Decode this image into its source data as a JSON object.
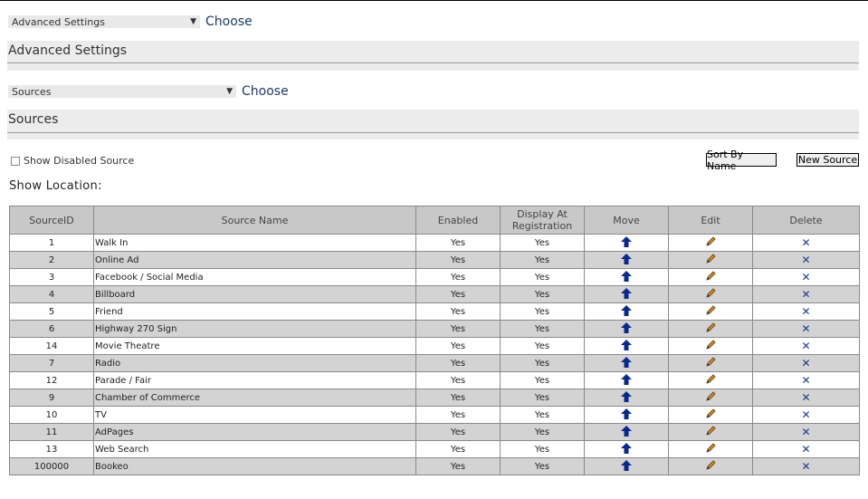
{
  "top_select": {
    "value": "Advanced Settings",
    "choose_label": "Choose"
  },
  "advanced_section": {
    "title": "Advanced Settings"
  },
  "source_select": {
    "value": "Sources",
    "choose_label": "Choose"
  },
  "sources_section": {
    "title": "Sources"
  },
  "show_disabled_label": "Show Disabled Source",
  "sort_by_name_label": "Sort By Name",
  "new_source_label": "New Source",
  "show_location_label": "Show Location:",
  "table": {
    "headers": [
      "SourceID",
      "Source Name",
      "Enabled",
      "Display At Registration",
      "Move",
      "Edit",
      "Delete"
    ],
    "rows": [
      {
        "id": "1",
        "name": "Walk In",
        "enabled": "Yes",
        "display": "Yes"
      },
      {
        "id": "2",
        "name": "Online Ad",
        "enabled": "Yes",
        "display": "Yes"
      },
      {
        "id": "3",
        "name": "Facebook / Social Media",
        "enabled": "Yes",
        "display": "Yes"
      },
      {
        "id": "4",
        "name": "Billboard",
        "enabled": "Yes",
        "display": "Yes"
      },
      {
        "id": "5",
        "name": "Friend",
        "enabled": "Yes",
        "display": "Yes"
      },
      {
        "id": "6",
        "name": "Highway 270 Sign",
        "enabled": "Yes",
        "display": "Yes"
      },
      {
        "id": "14",
        "name": "Movie Theatre",
        "enabled": "Yes",
        "display": "Yes"
      },
      {
        "id": "7",
        "name": "Radio",
        "enabled": "Yes",
        "display": "Yes"
      },
      {
        "id": "12",
        "name": "Parade / Fair",
        "enabled": "Yes",
        "display": "Yes"
      },
      {
        "id": "9",
        "name": "Chamber of Commerce",
        "enabled": "Yes",
        "display": "Yes"
      },
      {
        "id": "10",
        "name": "TV",
        "enabled": "Yes",
        "display": "Yes"
      },
      {
        "id": "11",
        "name": "AdPages",
        "enabled": "Yes",
        "display": "Yes"
      },
      {
        "id": "13",
        "name": "Web Search",
        "enabled": "Yes",
        "display": "Yes"
      },
      {
        "id": "100000",
        "name": "Bookeo",
        "enabled": "Yes",
        "display": "Yes"
      }
    ]
  },
  "icons": {
    "move": "arrow-up-icon",
    "edit": "pencil-icon",
    "delete": "close-icon"
  },
  "colors": {
    "header_bg": "#c8c8c8",
    "alt_row": "#d3d3d3",
    "link": "#1f3864",
    "delete": "#1f3a8a",
    "move": "#0a2a8a"
  }
}
